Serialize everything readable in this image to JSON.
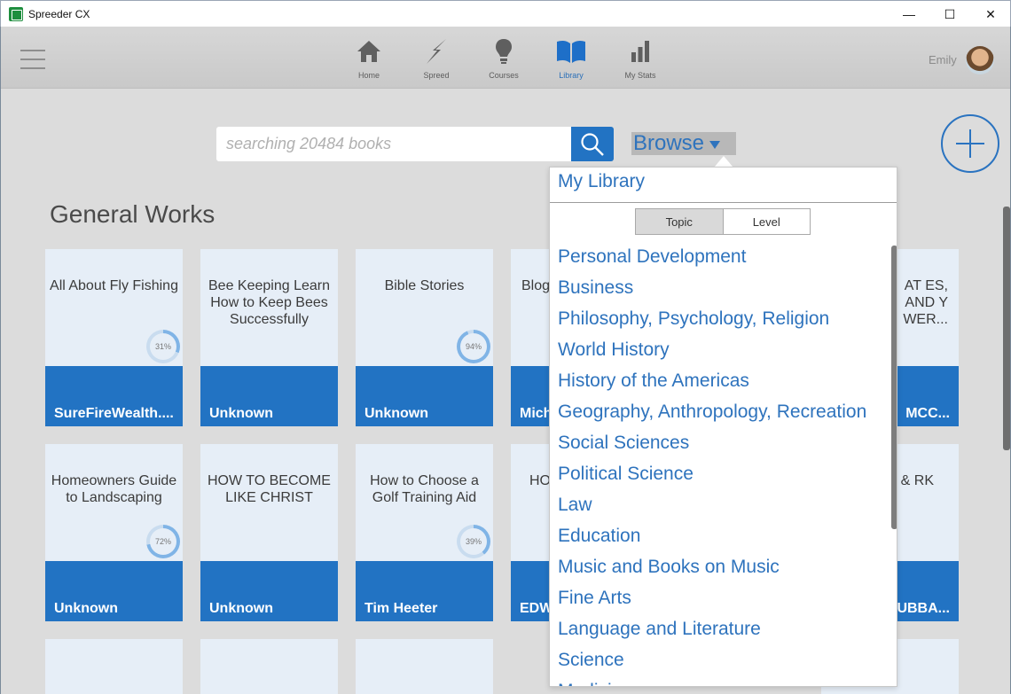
{
  "window": {
    "title": "Spreeder CX",
    "minimize_glyph": "—",
    "maximize_glyph": "☐",
    "close_glyph": "✕"
  },
  "nav": {
    "items": [
      {
        "label": "Home",
        "icon": "home-icon"
      },
      {
        "label": "Spreed",
        "icon": "lightning-icon"
      },
      {
        "label": "Courses",
        "icon": "lightbulb-icon"
      },
      {
        "label": "Library",
        "icon": "book-icon",
        "active": true
      },
      {
        "label": "My Stats",
        "icon": "bar-chart-icon"
      }
    ],
    "user_name": "Emily"
  },
  "search": {
    "placeholder": "searching 20484 books",
    "browse_label": "Browse"
  },
  "section": {
    "title": "General Works"
  },
  "books": [
    {
      "title": "All About Fly Fishing",
      "author": "SureFireWealth....",
      "progress_label": "31%",
      "progress": 0.31
    },
    {
      "title": "Bee Keeping Learn How to Keep Bees Successfully",
      "author": "Unknown"
    },
    {
      "title": "Bible Stories",
      "author": "Unknown",
      "progress_label": "94%",
      "progress": 0.94
    },
    {
      "title": "Blog",
      "author": "Mich"
    },
    {
      "title": "AT ES, AND Y WER...",
      "author": "MCC..."
    },
    {
      "title": "Homeowners Guide to Landscaping",
      "author": "Unknown",
      "progress_label": "72%",
      "progress": 0.72
    },
    {
      "title": "HOW TO BECOME LIKE CHRIST",
      "author": "Unknown"
    },
    {
      "title": "How to Choose a Golf Training Aid",
      "author": "Tim Heeter",
      "progress_label": "39%",
      "progress": 0.39
    },
    {
      "title": "HO",
      "author": "EDW"
    },
    {
      "title": "IFE & RK",
      "author": "UBBA..."
    }
  ],
  "browse_menu": {
    "my_library": "My Library",
    "segment": {
      "topic": "Topic",
      "level": "Level",
      "active": "Topic"
    },
    "categories": [
      "Personal Development",
      "Business",
      "Philosophy, Psychology, Religion",
      "World History",
      "History of the Americas",
      "Geography, Anthropology, Recreation",
      "Social Sciences",
      "Political Science",
      "Law",
      "Education",
      "Music and Books on Music",
      "Fine Arts",
      "Language and Literature",
      "Science",
      "Medicine"
    ]
  },
  "colors": {
    "accent": "#2273c3",
    "card_background": "#e6eef7",
    "progress_ring": "#80b4e6"
  }
}
